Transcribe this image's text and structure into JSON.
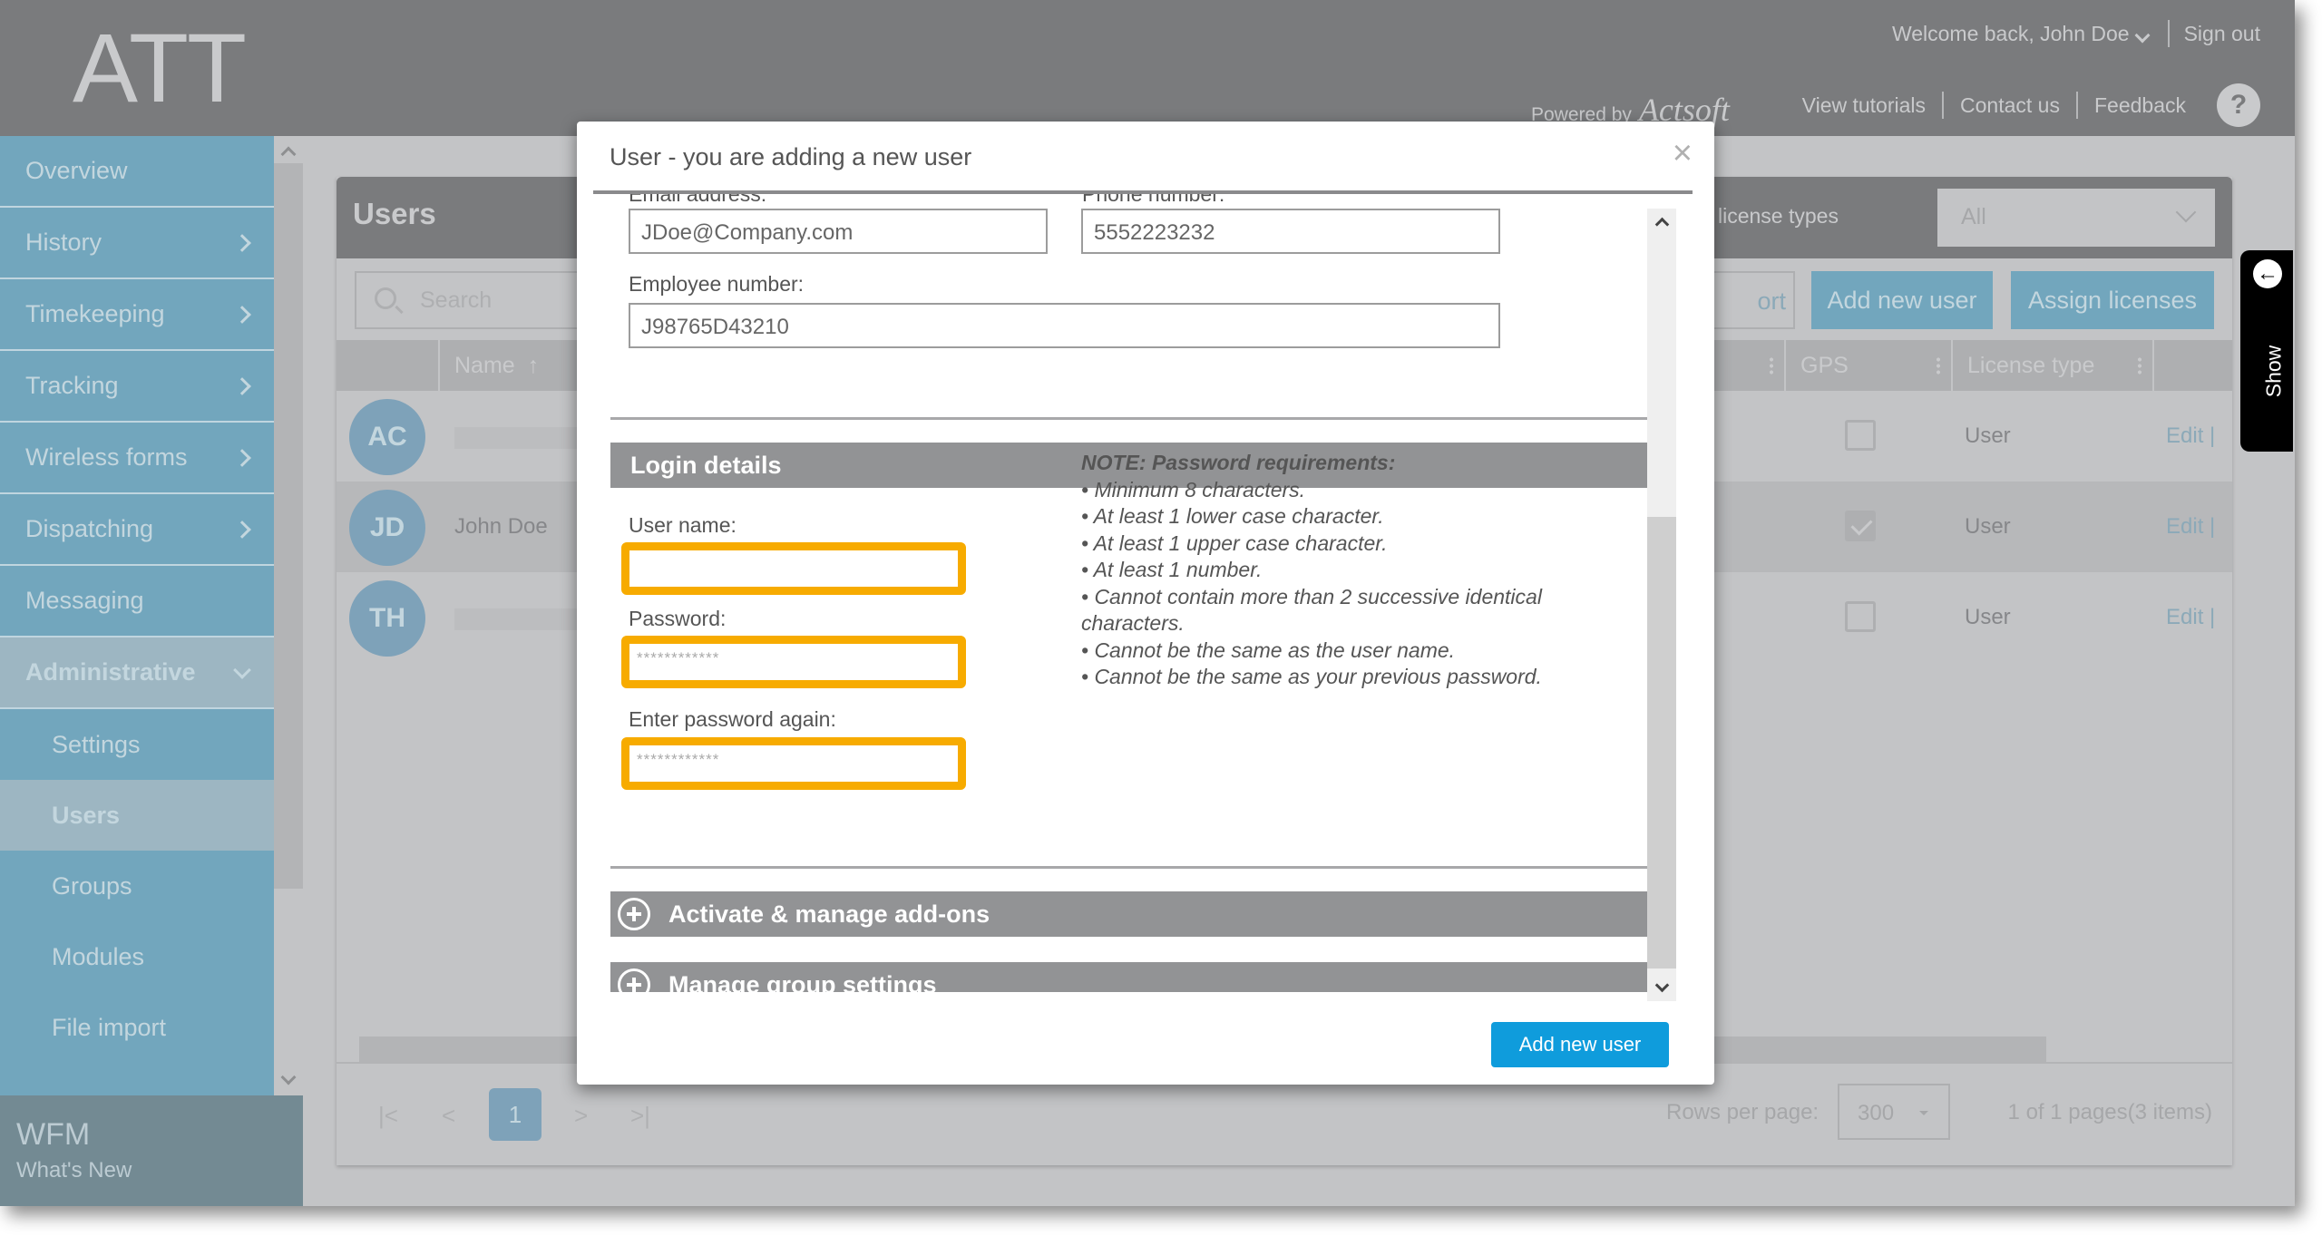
{
  "header": {
    "logo": "ATT",
    "welcome": "Welcome back, John Doe",
    "sign_out": "Sign out",
    "powered_by": "Powered by",
    "brand": "Actsoft",
    "links": [
      "View tutorials",
      "Contact us",
      "Feedback"
    ],
    "help": "?"
  },
  "sidebar": {
    "items": [
      {
        "label": "Overview",
        "expandable": false
      },
      {
        "label": "History",
        "expandable": true
      },
      {
        "label": "Timekeeping",
        "expandable": true
      },
      {
        "label": "Tracking",
        "expandable": true
      },
      {
        "label": "Wireless forms",
        "expandable": true
      },
      {
        "label": "Dispatching",
        "expandable": true
      },
      {
        "label": "Messaging",
        "expandable": false
      },
      {
        "label": "Administrative",
        "expandable": true,
        "expanded": true
      }
    ],
    "subitems": [
      "Settings",
      "Users",
      "Groups",
      "Modules",
      "File import"
    ],
    "active_subitem": "Users",
    "footer_title": "WFM",
    "footer_link": "What's New"
  },
  "users_panel": {
    "title": "Users",
    "license_filter_label": "w license types",
    "license_filter_value": "All",
    "search_placeholder": "Search",
    "export_label": "ort",
    "add_user_label": "Add new user",
    "assign_licenses_label": "Assign licenses",
    "columns": {
      "name": "Name",
      "gps": "GPS",
      "license_type": "License type"
    },
    "rows": [
      {
        "initials": "AC",
        "name": "",
        "gps": false,
        "license_type": "User",
        "actions": "Edit | "
      },
      {
        "initials": "JD",
        "name": "John Doe",
        "gps": true,
        "license_type": "User",
        "actions": "Edit | "
      },
      {
        "initials": "TH",
        "name": "",
        "gps": false,
        "license_type": "User",
        "actions": "Edit | "
      }
    ],
    "pager": {
      "first": "|<",
      "prev": "<",
      "current": "1",
      "next": ">",
      "last": ">|",
      "rows_per_page_label": "Rows per page:",
      "rows_per_page": "300",
      "info": "1 of 1 pages(3 items)"
    },
    "show_tab": "Show"
  },
  "modal": {
    "title": "User - you are adding a new user",
    "close": "×",
    "email_label": "Email address:",
    "email_value": "JDoe@Company.com",
    "phone_label": "Phone number:",
    "phone_value": "5552223232",
    "employee_label": "Employee number:",
    "employee_value": "J98765D43210",
    "login_section": "Login details",
    "username_label": "User name:",
    "username_value": "",
    "password_label": "Password:",
    "password_mask": "************",
    "password_again_label": "Enter password again:",
    "password_again_mask": "************",
    "note_title": "NOTE: Password requirements:",
    "requirements": [
      "• Minimum 8 characters.",
      "• At least 1 lower case character.",
      "• At least 1 upper case character.",
      "• At least 1 number.",
      "• Cannot contain more than 2 successive identical characters.",
      "• Cannot be the same as the user name.",
      "• Cannot be the same as your previous password."
    ],
    "addons_section": "Activate & manage add-ons",
    "groups_section": "Manage group settings",
    "submit": "Add new user"
  },
  "colors": {
    "highlight": "#f7ab00",
    "primary_button": "#0f9cdc",
    "sidebar": "#72a6bd",
    "section_header": "#929395"
  }
}
